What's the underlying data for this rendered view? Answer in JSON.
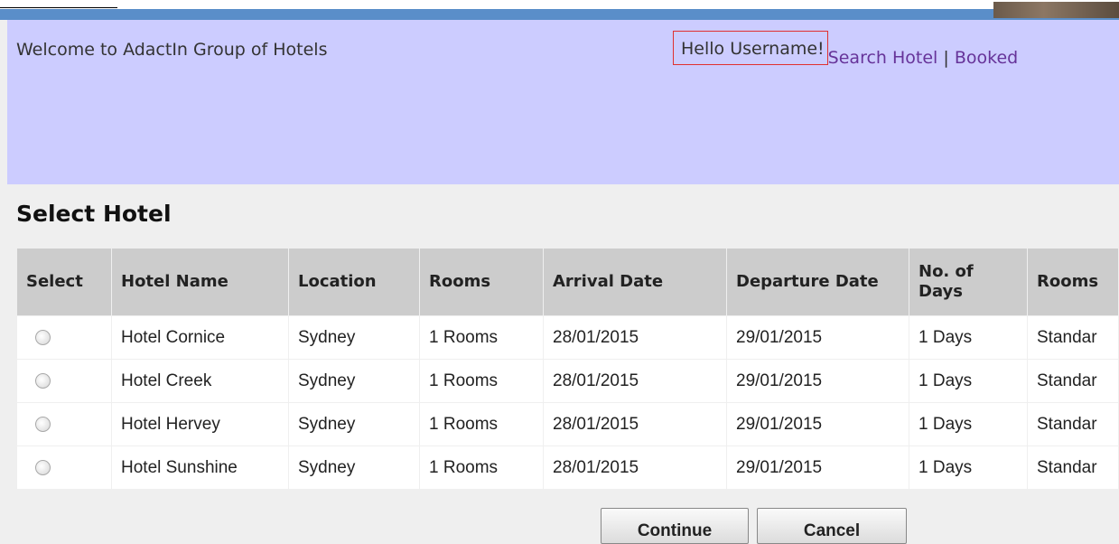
{
  "header": {
    "welcome": "Welcome to AdactIn Group of Hotels",
    "hello": "Hello Username!",
    "links": {
      "search_hotel": "Search Hotel",
      "separator": "|",
      "booked": "Booked"
    }
  },
  "page": {
    "title": "Select Hotel"
  },
  "table": {
    "headers": [
      "Select",
      "Hotel Name",
      "Location",
      "Rooms",
      "Arrival Date",
      "Departure Date",
      "No. of Days",
      "Rooms"
    ],
    "rows": [
      {
        "hotel": "Hotel Cornice",
        "location": "Sydney",
        "rooms": "1 Rooms",
        "arrival": "28/01/2015",
        "departure": "29/01/2015",
        "days": "1 Days",
        "room_type": "Standar"
      },
      {
        "hotel": "Hotel Creek",
        "location": "Sydney",
        "rooms": "1 Rooms",
        "arrival": "28/01/2015",
        "departure": "29/01/2015",
        "days": "1 Days",
        "room_type": "Standar"
      },
      {
        "hotel": "Hotel Hervey",
        "location": "Sydney",
        "rooms": "1 Rooms",
        "arrival": "28/01/2015",
        "departure": "29/01/2015",
        "days": "1 Days",
        "room_type": "Standar"
      },
      {
        "hotel": "Hotel Sunshine",
        "location": "Sydney",
        "rooms": "1 Rooms",
        "arrival": "28/01/2015",
        "departure": "29/01/2015",
        "days": "1 Days",
        "room_type": "Standar"
      }
    ]
  },
  "buttons": {
    "continue": "Continue",
    "cancel": "Cancel"
  },
  "colors": {
    "header_bg": "#ccccff",
    "link": "#663399",
    "highlight_border": "#e03030",
    "table_header_bg": "#cccccc"
  }
}
